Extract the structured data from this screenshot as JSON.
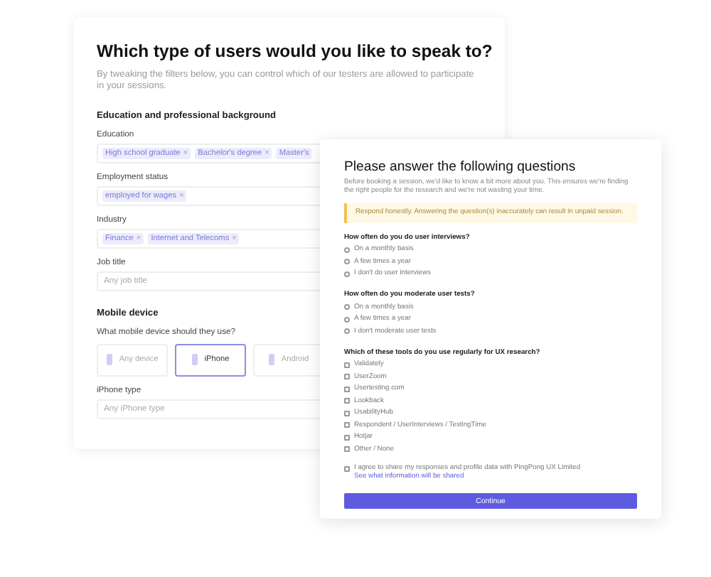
{
  "filters": {
    "title": "Which type of users would you like to speak to?",
    "subtitle": "By tweaking the filters below, you can control which of our testers are allowed to participate in your sessions.",
    "sections": [
      {
        "heading": "Education and professional background",
        "fields": [
          {
            "kind": "chips",
            "label": "Education",
            "chips": [
              {
                "label": "High school graduate",
                "remove": "×"
              },
              {
                "label": "Bachelor's degree",
                "remove": "×"
              },
              {
                "label": "Master's"
              }
            ]
          },
          {
            "kind": "chips",
            "label": "Employment status",
            "chips": [
              {
                "label": "employed for wages",
                "remove": "×"
              }
            ]
          },
          {
            "kind": "chips",
            "label": "Industry",
            "chips": [
              {
                "label": "Finance",
                "remove": "×"
              },
              {
                "label": "Internet and Telecoms",
                "remove": "×"
              }
            ]
          },
          {
            "kind": "text",
            "label": "Job title",
            "placeholder": "Any job title"
          }
        ]
      },
      {
        "heading": "Mobile device",
        "fields": [
          {
            "kind": "devices",
            "label": "What mobile device should they use?",
            "options": [
              {
                "label": "Any device",
                "selected": false
              },
              {
                "label": "iPhone",
                "selected": true
              },
              {
                "label": "Android",
                "selected": false
              }
            ]
          },
          {
            "kind": "text",
            "label": "iPhone type",
            "placeholder": "Any iPhone type"
          }
        ]
      }
    ]
  },
  "survey": {
    "title": "Please answer the following questions",
    "intro": "Before booking a session, we'd like to know a bit more about you. This ensures we're finding the right people for the research and we're not wasting your time.",
    "warning": "Respond honestly. Answering the question(s) inaccurately can result in unpaid session.",
    "questions": [
      {
        "kind": "radio",
        "text": "How often do you do user interviews?",
        "options": [
          {
            "label": "On a monthly basis",
            "checked": false
          },
          {
            "label": "A few times a year",
            "checked": false
          },
          {
            "label": "I don't do user interviews",
            "checked": false
          }
        ]
      },
      {
        "kind": "radio",
        "text": "How often do you moderate user tests?",
        "options": [
          {
            "label": "On a monthly basis",
            "checked": false
          },
          {
            "label": "A few times a year",
            "checked": false
          },
          {
            "label": "I don't moderate user tests",
            "checked": false
          }
        ]
      },
      {
        "kind": "checkbox",
        "text": "Which of these tools do you use regularly for UX research?",
        "options": [
          {
            "label": "Validately",
            "checked": false
          },
          {
            "label": "UserZoom",
            "checked": false
          },
          {
            "label": "Usertesting.com",
            "checked": false
          },
          {
            "label": "Lookback",
            "checked": false
          },
          {
            "label": "UsabilityHub",
            "checked": false
          },
          {
            "label": "Respondent / UserInterviews / TestingTime",
            "checked": false
          },
          {
            "label": "Hotjar",
            "checked": false
          },
          {
            "label": "Other / None",
            "checked": false
          }
        ]
      }
    ],
    "consent": {
      "text": "I agree to share my responses and profile data with PingPong UX Limited",
      "link": "See what information will be shared",
      "checked": false
    },
    "button": "Continue"
  }
}
